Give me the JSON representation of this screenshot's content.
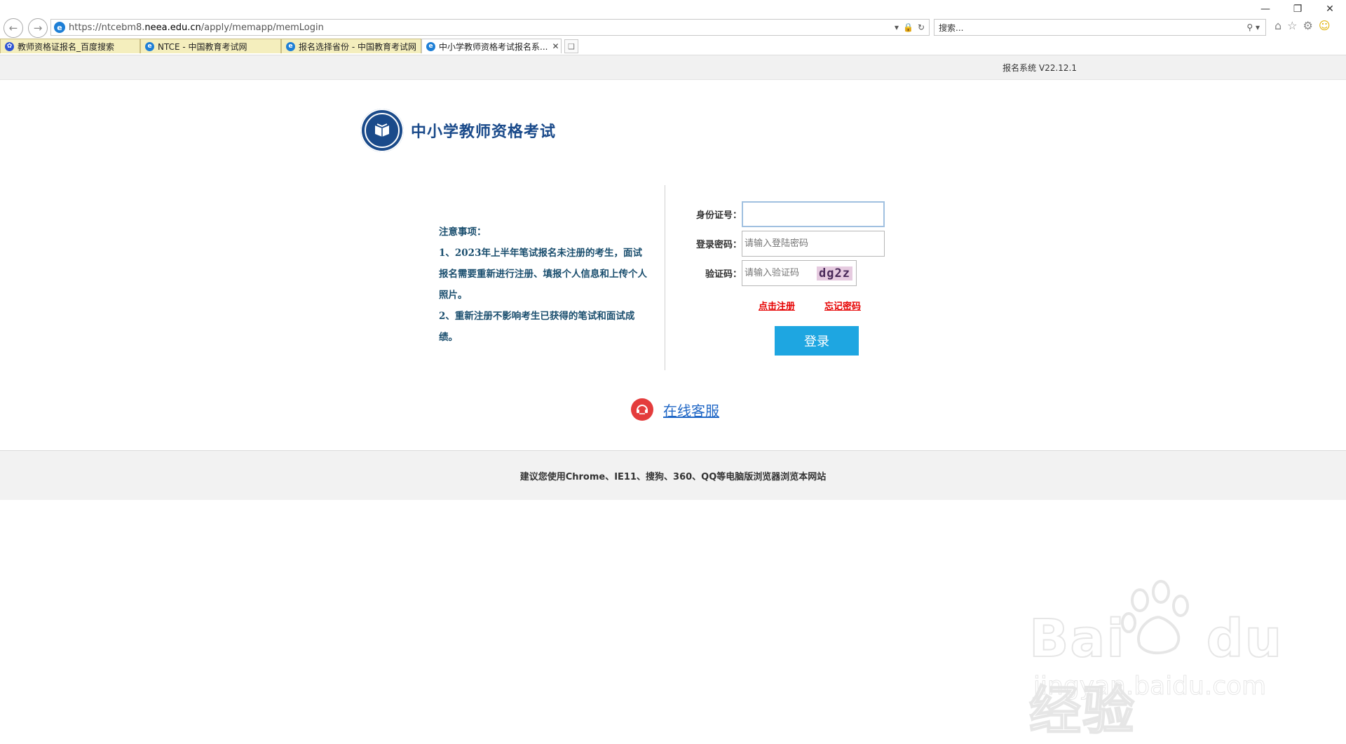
{
  "browser": {
    "url_prefix": "https://ntcebm8.",
    "url_domain": "neea.edu.cn",
    "url_path": "/apply/memapp/memLogin",
    "search_placeholder": "搜索...",
    "tabs": [
      {
        "label": "教师资格证报名_百度搜索",
        "icon": "baidu-paw-icon",
        "active": false
      },
      {
        "label": "NTCE - 中国教育考试网",
        "icon": "ie-page-icon",
        "active": false
      },
      {
        "label": "报名选择省份 - 中国教育考试网",
        "icon": "ie-page-icon",
        "active": false
      },
      {
        "label": "中小学教师资格考试报名系...",
        "icon": "ie-page-icon",
        "active": true
      }
    ]
  },
  "page": {
    "version": "报名系统 V22.12.1",
    "site_title": "中小学教师资格考试",
    "notice": {
      "heading": "注意事项：",
      "item1": "1、2023年上半年笔试报名未注册的考生，面试报名需要重新进行注册、填报个人信息和上传个人照片。",
      "item2": "2、重新注册不影响考生已获得的笔试和面试成绩。"
    },
    "form": {
      "id_label": "身份证号：",
      "id_value": "",
      "password_label": "登录密码：",
      "password_placeholder": "请输入登陆密码",
      "captcha_label": "验证码：",
      "captcha_placeholder": "请输入验证码",
      "captcha_text": "dg2z",
      "register_link": "点击注册",
      "forgot_link": "忘记密码",
      "login_button": "登录"
    },
    "service_link": "在线客服",
    "footer": "建议您使用Chrome、IE11、搜狗、360、QQ等电脑版浏览器浏览本网站"
  },
  "watermark": {
    "brand": "Bai du 经验",
    "url": "jingyan.baidu.com"
  },
  "colors": {
    "brand_blue": "#1a4a8a",
    "login_button": "#1ea6e1",
    "link_red": "#e60000",
    "service_red": "#e43c3c"
  }
}
